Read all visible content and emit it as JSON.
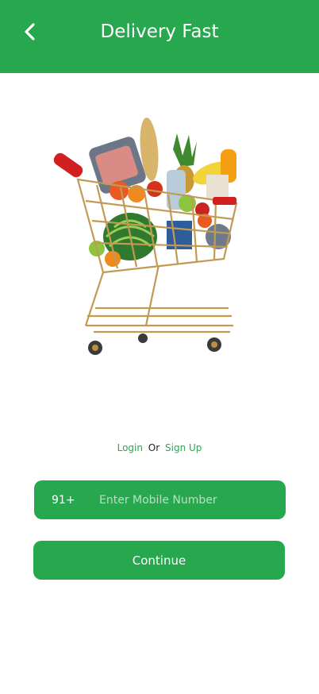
{
  "colors": {
    "brand": "#27a84f",
    "background": "#ffffff",
    "placeholder": "#b6e0c3"
  },
  "header": {
    "title": "Delivery Fast",
    "back_icon": "chevron-left-icon"
  },
  "hero": {
    "image": "shopping-cart-with-groceries"
  },
  "auth": {
    "login_label": "Login",
    "or_label": "Or",
    "signup_label": "Sign Up"
  },
  "phone": {
    "country_code": "91+",
    "placeholder": "Enter Mobile Number",
    "value": ""
  },
  "actions": {
    "continue_label": "Continue"
  }
}
